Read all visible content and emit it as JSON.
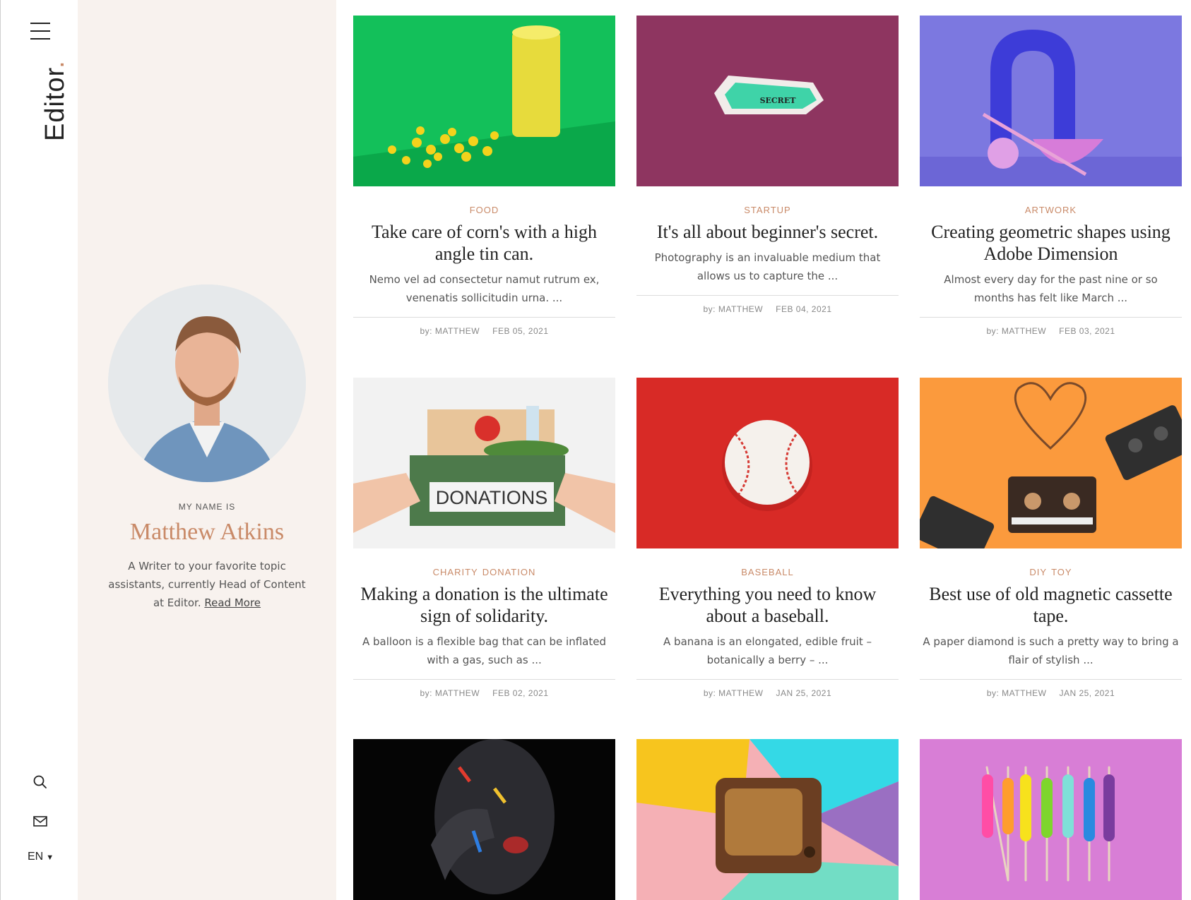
{
  "brand": {
    "name": "Editor",
    "dot": "."
  },
  "rail": {
    "language": "EN"
  },
  "profile": {
    "label": "MY NAME IS",
    "name": "Matthew Atkins",
    "bio": "A Writer to your favorite topic assistants, currently Head of Content at Editor.",
    "read_more": "Read More"
  },
  "posts": [
    {
      "categories": [
        "FOOD"
      ],
      "title": "Take care of corn's with a high angle tin can.",
      "excerpt": "Nemo vel ad consectetur namut rutrum ex, venenatis sollicitudin urna. ...",
      "author": "by: MATTHEW",
      "date": "FEB 05, 2021"
    },
    {
      "categories": [
        "STARTUP"
      ],
      "title": "It's all about beginner's secret.",
      "excerpt": "Photography is an invaluable medium that allows us to capture the ...",
      "author": "by: MATTHEW",
      "date": "FEB 04, 2021"
    },
    {
      "categories": [
        "ARTWORK"
      ],
      "title": "Creating geometric shapes using Adobe Dimension",
      "excerpt": "Almost every day for the past nine or so months has felt like March ...",
      "author": "by: MATTHEW",
      "date": "FEB 03, 2021"
    },
    {
      "categories": [
        "CHARITY",
        "DONATION"
      ],
      "title": "Making a donation is the ultimate sign of solidarity.",
      "excerpt": "A balloon is a flexible bag that can be inflated with a gas, such as ...",
      "author": "by: MATTHEW",
      "date": "FEB 02, 2021"
    },
    {
      "categories": [
        "BASEBALL"
      ],
      "title": "Everything you need to know about a baseball.",
      "excerpt": "A banana is an elongated, edible fruit – botanically a berry – ...",
      "author": "by: MATTHEW",
      "date": "JAN 25, 2021"
    },
    {
      "categories": [
        "DIY",
        "TOY"
      ],
      "title": "Best use of old magnetic cassette tape.",
      "excerpt": "A paper diamond is such a pretty way to bring a flair of stylish ...",
      "author": "by: MATTHEW",
      "date": "JAN 25, 2021"
    }
  ],
  "images": {
    "secret_tag": "SECRET",
    "donations_label": "DONATIONS"
  },
  "colors": {
    "accent": "#c98a68",
    "sidebar_bg": "#f8f2ee"
  }
}
